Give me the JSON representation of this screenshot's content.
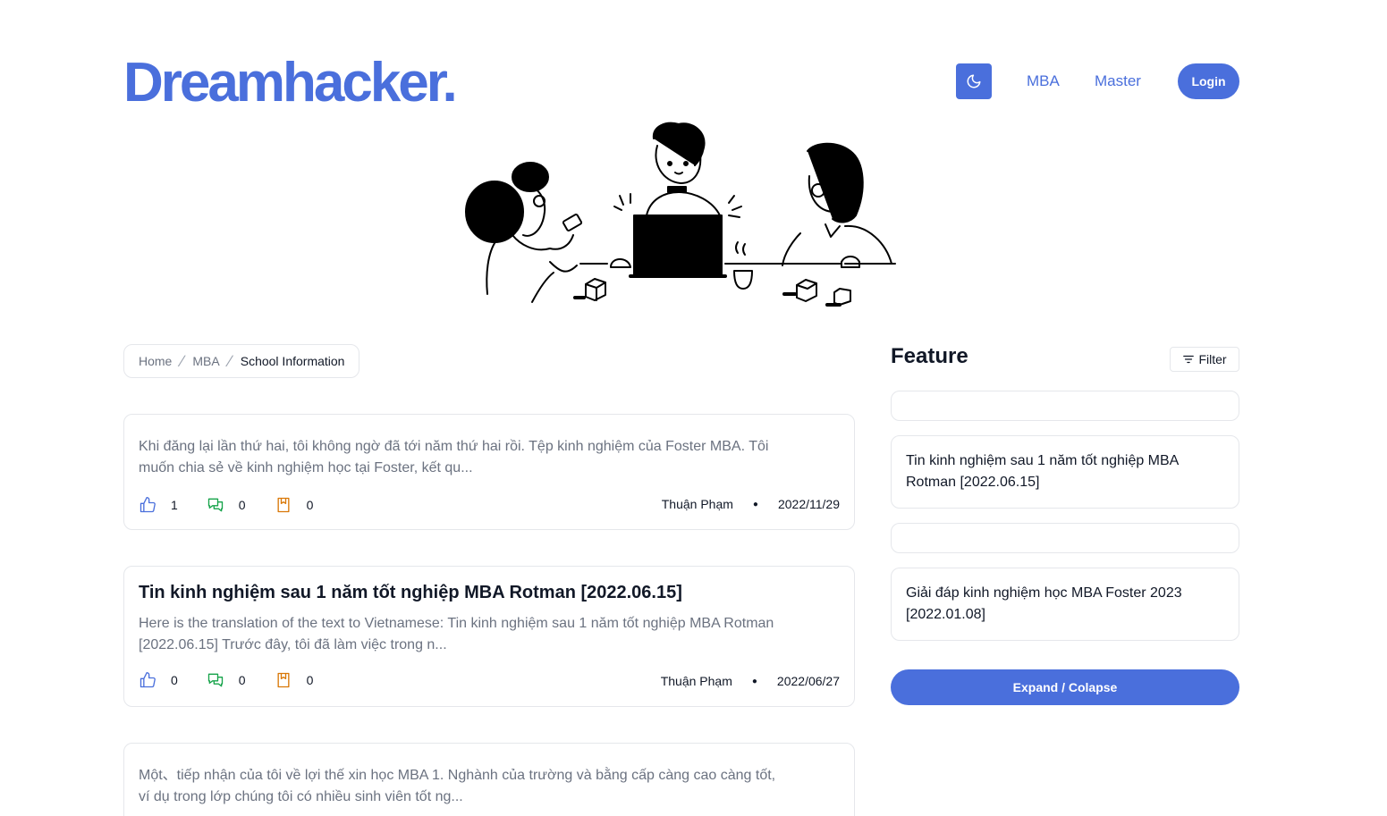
{
  "header": {
    "logo": "Dreamhacker.",
    "nav": {
      "mba": "MBA",
      "master": "Master"
    },
    "login_label": "Login",
    "theme_icon": "moon-icon"
  },
  "breadcrumb": {
    "home": "Home",
    "mba": "MBA",
    "current": "School Information"
  },
  "posts": [
    {
      "title": "",
      "excerpt": "Khi đăng lại lần thứ hai, tôi không ngờ đã tới năm thứ hai rồi. Tệp kinh nghiệm của Foster MBA. Tôi muốn chia sẻ về kinh nghiệm học tại Foster, kết qu...",
      "likes": "1",
      "comments": "0",
      "bookmarks": "0",
      "author": "Thuận Phạm",
      "date": "2022/11/29"
    },
    {
      "title": "Tin kinh nghiệm sau 1 năm tốt nghiệp MBA Rotman [2022.06.15]",
      "excerpt": "Here is the translation of the text to Vietnamese: Tin kinh nghiệm sau 1 năm tốt nghiệp MBA Rotman [2022.06.15] Trước đây, tôi đã làm việc trong n...",
      "likes": "0",
      "comments": "0",
      "bookmarks": "0",
      "author": "Thuận Phạm",
      "date": "2022/06/27"
    },
    {
      "title": "",
      "excerpt": "Một、tiếp nhận của tôi về lợi thế xin học MBA 1. Nghành của trường và bằng cấp càng cao càng tốt, ví dụ trong lớp chúng tôi có nhiều sinh viên tốt ng..."
    }
  ],
  "sidebar": {
    "title": "Feature",
    "filter_label": "Filter",
    "items": [
      "Tin kinh nghiệm sau 1 năm tốt nghiệp MBA Rotman [2022.06.15]",
      "Giải đáp kinh nghiệm học MBA Foster 2023 [2022.01.08]"
    ],
    "expand_label": "Expand / Colapse"
  },
  "colors": {
    "accent": "#4a6fdc",
    "like_icon": "#4a6fdc",
    "comment_icon": "#16a34a",
    "bookmark_icon": "#d97706"
  }
}
